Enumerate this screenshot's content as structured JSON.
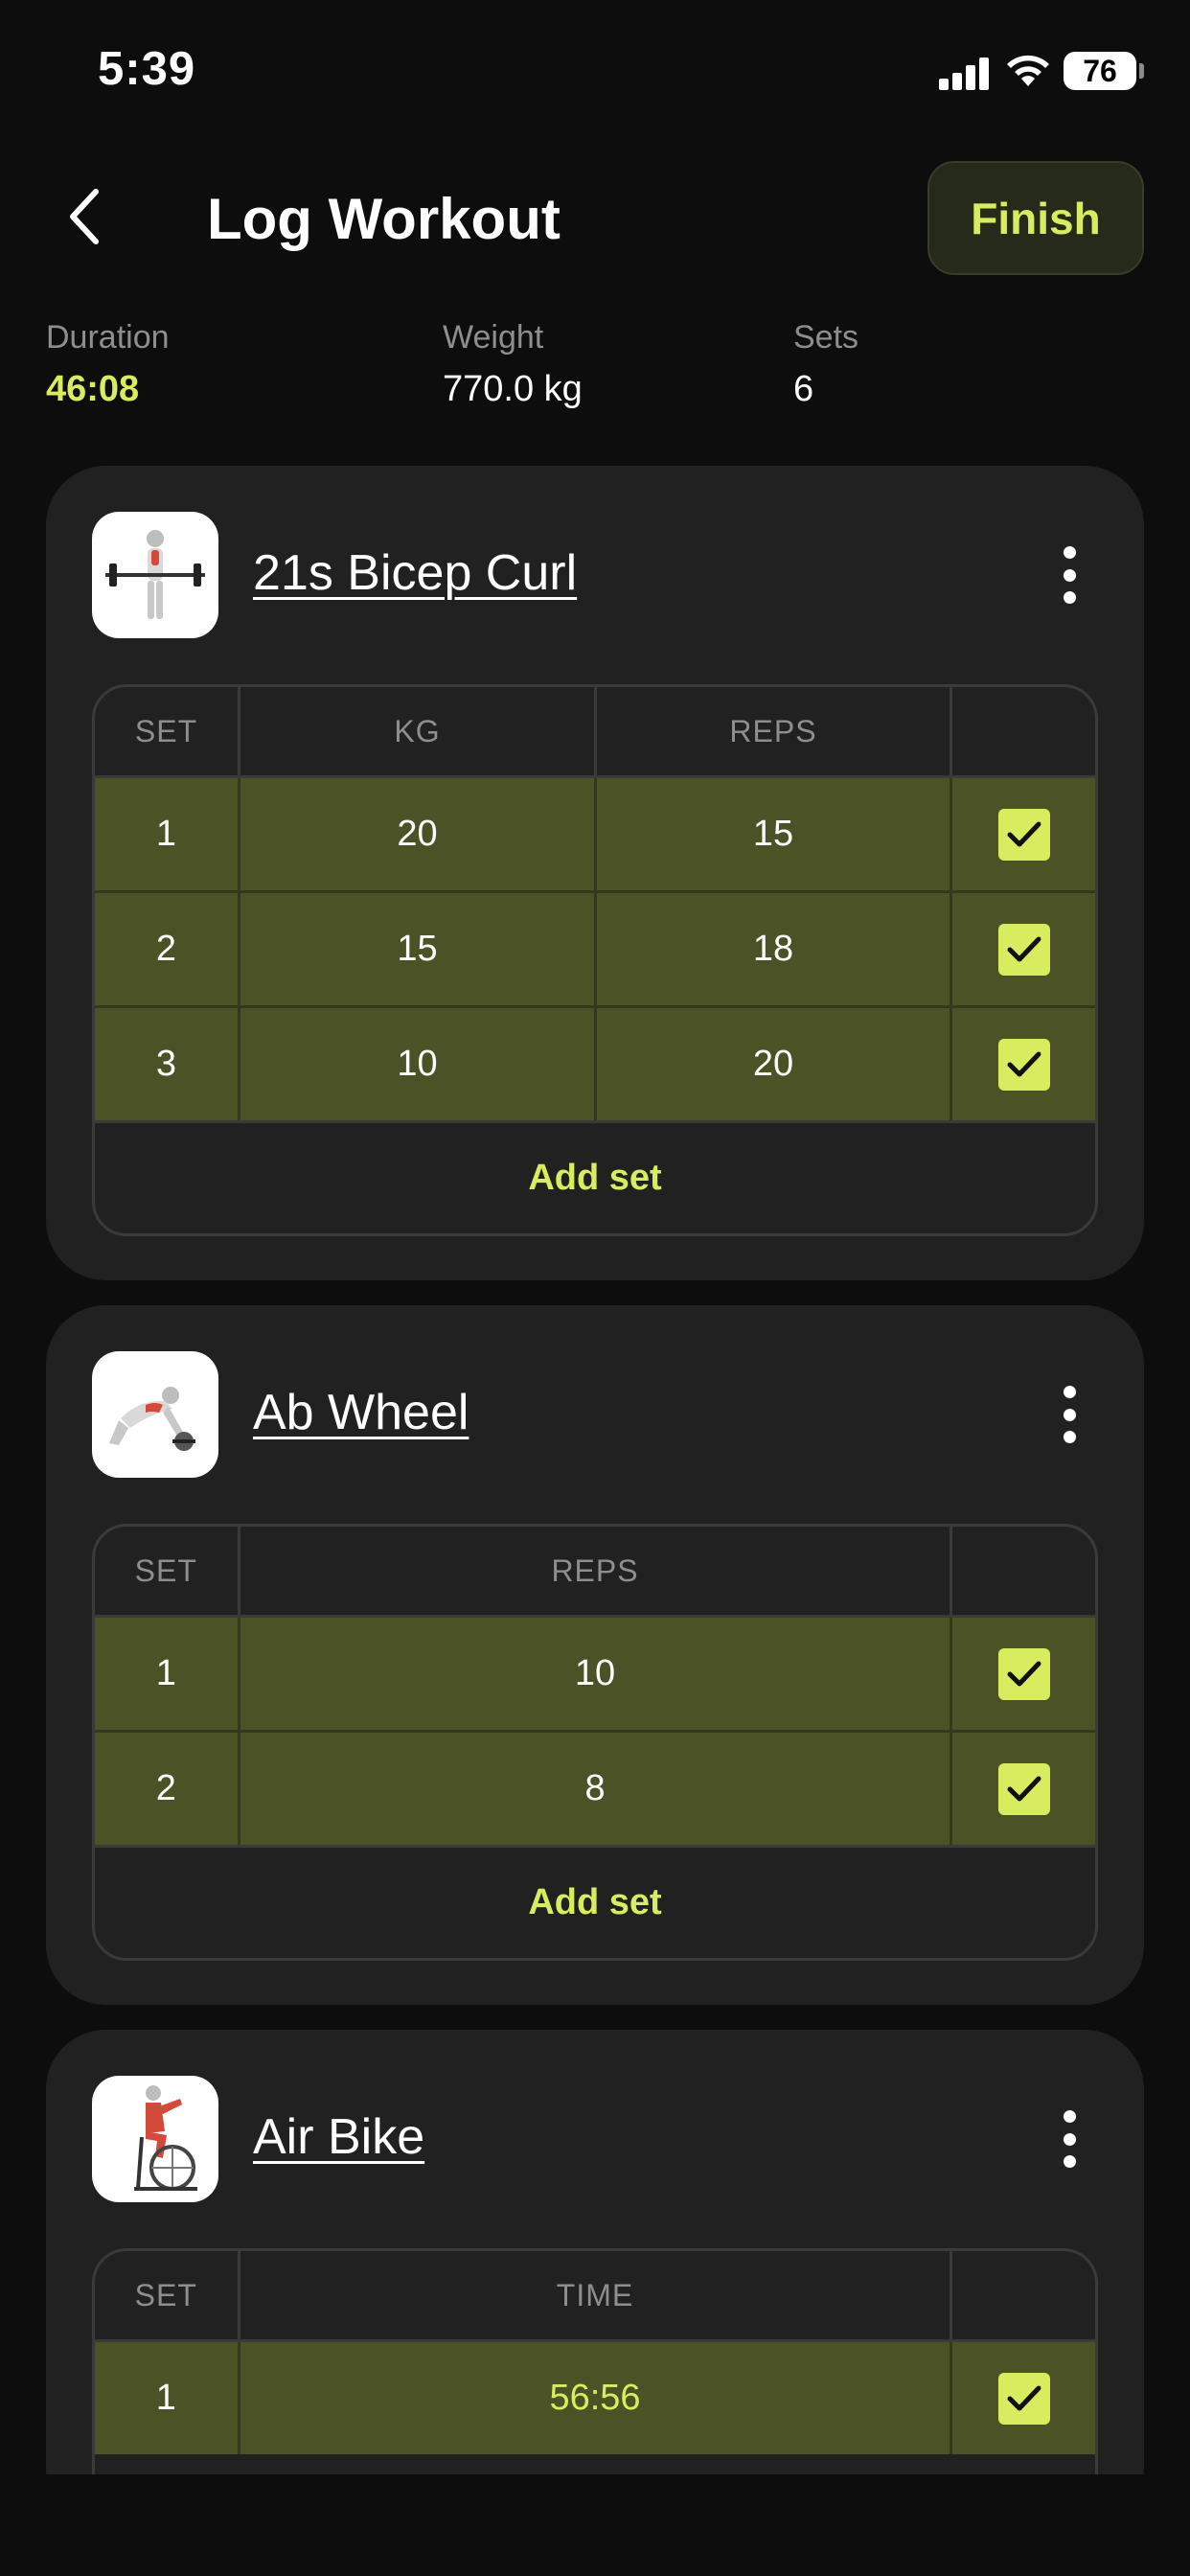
{
  "status_bar": {
    "time": "5:39",
    "battery": "76"
  },
  "header": {
    "title": "Log Workout",
    "finish_label": "Finish"
  },
  "stats": [
    {
      "label": "Duration",
      "value": "46:08"
    },
    {
      "label": "Weight",
      "value": "770.0 kg"
    },
    {
      "label": "Sets",
      "value": "6"
    }
  ],
  "exercises": [
    {
      "name": "21s Bicep Curl",
      "columns": [
        "SET",
        "KG",
        "REPS"
      ],
      "sets": [
        {
          "set": "1",
          "kg": "20",
          "reps": "15",
          "done": true
        },
        {
          "set": "2",
          "kg": "15",
          "reps": "18",
          "done": true
        },
        {
          "set": "3",
          "kg": "10",
          "reps": "20",
          "done": true
        }
      ],
      "add_label": "Add set"
    },
    {
      "name": "Ab Wheel",
      "columns": [
        "SET",
        "REPS"
      ],
      "sets": [
        {
          "set": "1",
          "reps": "10",
          "done": true
        },
        {
          "set": "2",
          "reps": "8",
          "done": true
        }
      ],
      "add_label": "Add set"
    },
    {
      "name": "Air Bike",
      "columns": [
        "SET",
        "TIME"
      ],
      "sets": [
        {
          "set": "1",
          "time": "56:56",
          "done": true
        }
      ]
    }
  ],
  "colors": {
    "accent": "#d7ec5f",
    "completed_row": "#4a5226",
    "card": "#212121",
    "background": "#0d0d0d"
  },
  "icons": [
    "back-chevron-icon",
    "more-vertical-icon",
    "checkmark-icon",
    "signal-icon",
    "wifi-icon",
    "battery-icon"
  ]
}
